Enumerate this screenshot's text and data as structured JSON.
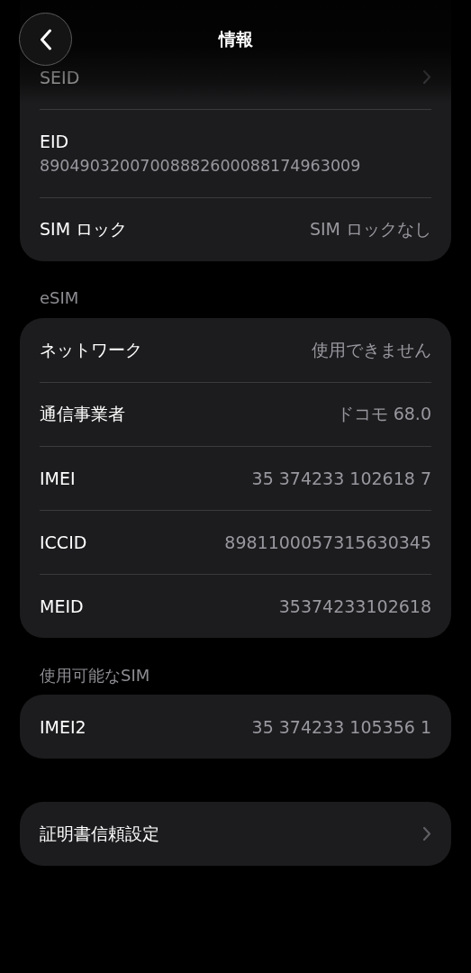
{
  "nav": {
    "title": "情報"
  },
  "groups": [
    {
      "rows": [
        {
          "kind": "link",
          "label": "SEID"
        },
        {
          "kind": "stacked",
          "label": "EID",
          "value": "89049032007008882600088174963009"
        },
        {
          "kind": "value",
          "label": "SIM ロック",
          "value": "SIM ロックなし"
        }
      ]
    },
    {
      "header": "eSIM",
      "rows": [
        {
          "kind": "value",
          "label": "ネットワーク",
          "value": "使用できません"
        },
        {
          "kind": "value",
          "label": "通信事業者",
          "value": "ドコモ 68.0"
        },
        {
          "kind": "value",
          "label": "IMEI",
          "value": "35 374233 102618 7"
        },
        {
          "kind": "value",
          "label": "ICCID",
          "value": "8981100057315630345"
        },
        {
          "kind": "value",
          "label": "MEID",
          "value": "35374233102618"
        }
      ]
    },
    {
      "header": "使用可能なSIM",
      "rows": [
        {
          "kind": "value",
          "label": "IMEI2",
          "value": "35 374233 105356 1"
        }
      ]
    },
    {
      "rows": [
        {
          "kind": "link",
          "label": "証明書信頼設定"
        }
      ]
    }
  ]
}
